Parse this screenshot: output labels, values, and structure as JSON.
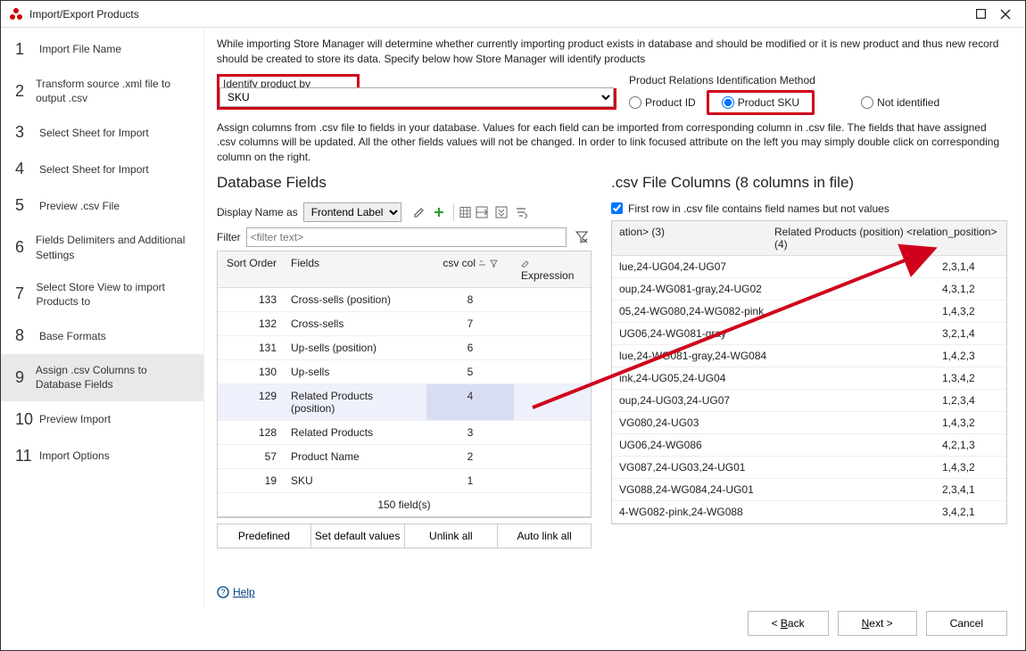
{
  "window": {
    "title": "Import/Export Products"
  },
  "sidebar": {
    "steps": [
      {
        "num": "1",
        "label": "Import File Name"
      },
      {
        "num": "2",
        "label": "Transform source .xml file to output .csv"
      },
      {
        "num": "3",
        "label": "Select Sheet for Import"
      },
      {
        "num": "4",
        "label": "Select Sheet for Import"
      },
      {
        "num": "5",
        "label": "Preview .csv File"
      },
      {
        "num": "6",
        "label": "Fields Delimiters and Additional Settings"
      },
      {
        "num": "7",
        "label": "Select Store View to import Products to"
      },
      {
        "num": "8",
        "label": "Base Formats"
      },
      {
        "num": "9",
        "label": "Assign .csv Columns to Database Fields"
      },
      {
        "num": "10",
        "label": "Preview Import"
      },
      {
        "num": "11",
        "label": "Import Options"
      }
    ],
    "active": 8
  },
  "intro": "While importing Store Manager will determine whether currently importing product exists in database and should be modified or it is new product and thus new record should be created to store its data. Specify below how Store Manager will identify products",
  "identify": {
    "label": "Identify product by",
    "value": "SKU"
  },
  "relations": {
    "label": "Product Relations Identification Method",
    "options": {
      "product_id": "Product ID",
      "product_sku": "Product SKU",
      "not_identified": "Not identified"
    },
    "selected": "product_sku"
  },
  "assign_note": "Assign columns from .csv file to fields in your database. Values for each field can be imported from corresponding column in .csv file. The fields that have assigned .csv columns will be updated. All the other fields values will not be changed. In order to link focused attribute on the left you may simply double click on corresponding column on the right.",
  "left": {
    "title": "Database Fields",
    "display_label": "Display Name as",
    "display_value": "Frontend Label",
    "filter_label": "Filter",
    "filter_placeholder": "<filter text>",
    "headers": {
      "sort": "Sort Order",
      "fields": "Fields",
      "csv": "csv col",
      "expr": "Expression"
    },
    "rows": [
      {
        "sort": "133",
        "field": "Cross-sells (position)",
        "csv": "8"
      },
      {
        "sort": "132",
        "field": "Cross-sells",
        "csv": "7"
      },
      {
        "sort": "131",
        "field": "Up-sells (position)",
        "csv": "6"
      },
      {
        "sort": "130",
        "field": "Up-sells",
        "csv": "5"
      },
      {
        "sort": "129",
        "field": "Related Products (position)",
        "csv": "4",
        "sel": true
      },
      {
        "sort": "128",
        "field": "Related Products",
        "csv": "3"
      },
      {
        "sort": "57",
        "field": "Product Name",
        "csv": "2"
      },
      {
        "sort": "19",
        "field": "SKU",
        "csv": "1"
      }
    ],
    "footer": "150 field(s)",
    "buttons": {
      "predefined": "Predefined",
      "set_default": "Set default values",
      "unlink": "Unlink all",
      "autolink": "Auto link all"
    }
  },
  "right": {
    "title": ".csv File Columns (8 columns in file)",
    "first_row_label": "First row in .csv file contains field names but not values",
    "first_row_checked": true,
    "headers": {
      "c1": "ation> (3)",
      "c2": "Related Products (position) <relation_position> (4)"
    },
    "rows": [
      {
        "a": "lue,24-UG04,24-UG07",
        "b": "2,3,1,4"
      },
      {
        "a": "oup,24-WG081-gray,24-UG02",
        "b": "4,3,1,2"
      },
      {
        "a": "05,24-WG080,24-WG082-pink",
        "b": "1,4,3,2"
      },
      {
        "a": "UG06,24-WG081-gray",
        "b": "3,2,1,4"
      },
      {
        "a": "lue,24-WG081-gray,24-WG084",
        "b": "1,4,2,3"
      },
      {
        "a": "ink,24-UG05,24-UG04",
        "b": "1,3,4,2"
      },
      {
        "a": "oup,24-UG03,24-UG07",
        "b": "1,2,3,4"
      },
      {
        "a": "VG080,24-UG03",
        "b": "1,4,3,2"
      },
      {
        "a": "UG06,24-WG086",
        "b": "4,2,1,3"
      },
      {
        "a": "VG087,24-UG03,24-UG01",
        "b": "1,4,3,2"
      },
      {
        "a": "VG088,24-WG084,24-UG01",
        "b": "2,3,4,1"
      },
      {
        "a": "4-WG082-pink,24-WG088",
        "b": "3,4,2,1"
      }
    ]
  },
  "help": "Help",
  "footer": {
    "back": "Back",
    "next": "Next >",
    "cancel": "Cancel"
  }
}
